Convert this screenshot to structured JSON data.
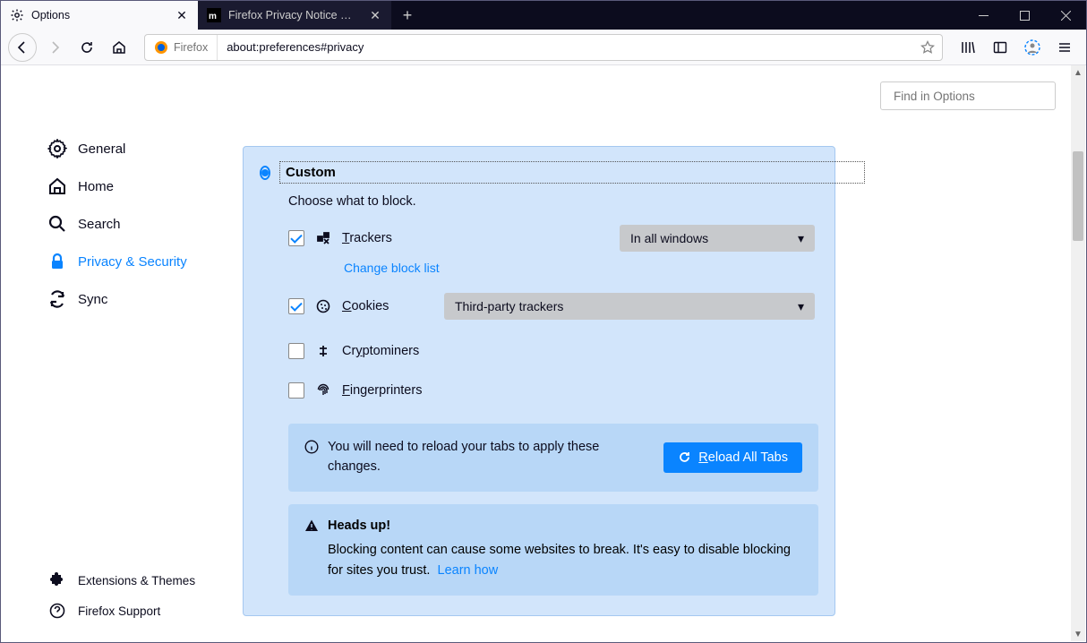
{
  "window": {
    "tabs": [
      {
        "label": "Options",
        "active": true
      },
      {
        "label": "Firefox Privacy Notice — Mozilla",
        "active": false
      }
    ]
  },
  "urlbar": {
    "identity": "Firefox",
    "url": "about:preferences#privacy"
  },
  "search": {
    "placeholder": "Find in Options"
  },
  "sidebar": {
    "items": [
      {
        "label": "General"
      },
      {
        "label": "Home"
      },
      {
        "label": "Search"
      },
      {
        "label": "Privacy & Security"
      },
      {
        "label": "Sync"
      }
    ],
    "bottom": [
      {
        "label": "Extensions & Themes"
      },
      {
        "label": "Firefox Support"
      }
    ]
  },
  "panel": {
    "title": "Custom",
    "subtitle": "Choose what to block.",
    "trackers": {
      "label": "Trackers",
      "checked": true,
      "dropdown": "In all windows",
      "change_link": "Change block list"
    },
    "cookies": {
      "label": "Cookies",
      "checked": true,
      "dropdown": "Third-party trackers"
    },
    "cryptominers": {
      "label": "Cryptominers",
      "checked": false
    },
    "fingerprinters": {
      "label": "Fingerprinters",
      "checked": false
    },
    "reload_msg": "You will need to reload your tabs to apply these changes.",
    "reload_btn": "Reload All Tabs",
    "warn_title": "Heads up!",
    "warn_body": "Blocking content can cause some websites to break. It's easy to disable blocking for sites you trust.",
    "warn_link": "Learn how"
  }
}
